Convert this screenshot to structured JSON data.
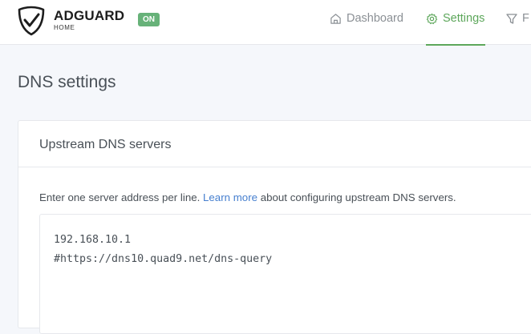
{
  "header": {
    "brand": "ADGUARD",
    "brand_sub": "HOME",
    "status_badge": "ON",
    "nav": [
      {
        "label": "Dashboard",
        "icon": "home-icon"
      },
      {
        "label": "Settings",
        "icon": "gear-icon",
        "active": true
      },
      {
        "label": "F",
        "icon": "filter-icon"
      }
    ]
  },
  "page": {
    "title": "DNS settings"
  },
  "upstream_card": {
    "title": "Upstream DNS servers",
    "description_before": "Enter one server address per line.",
    "learn_more": "Learn more",
    "description_after": "about configuring upstream DNS servers.",
    "servers": [
      "192.168.10.1",
      "#https://dns10.quad9.net/dns-query"
    ]
  },
  "colors": {
    "accent_green": "#5da75b",
    "badge_green": "#67b279",
    "link_blue": "#467fcf",
    "background": "#f5f7fb"
  }
}
